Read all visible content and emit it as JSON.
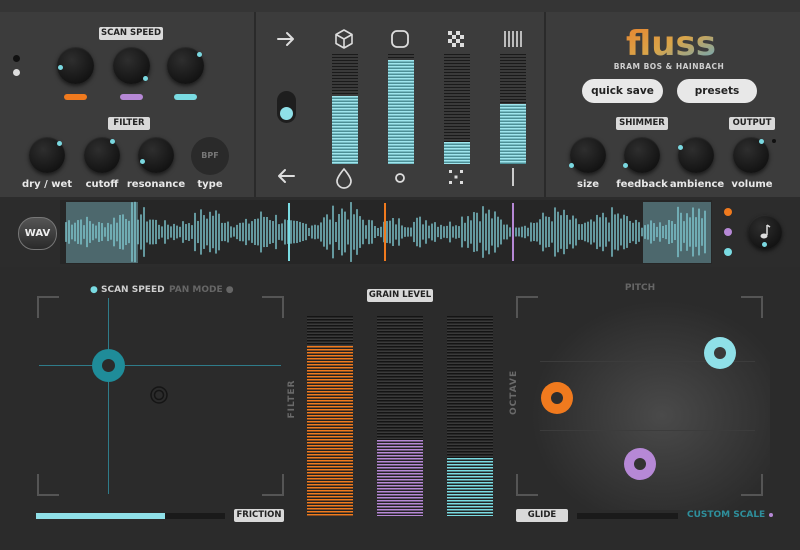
{
  "top": {
    "scan_speed_label": "SCAN SPEED",
    "filter_label": "FILTER",
    "filter_knobs": [
      {
        "label": "dry / wet"
      },
      {
        "label": "cutoff"
      },
      {
        "label": "resonance"
      },
      {
        "label": "type",
        "button_text": "BPF"
      }
    ],
    "scan_speed_colors": [
      "#f07a1e",
      "#b688d6",
      "#7adbe2"
    ],
    "sliders": [
      {
        "top_icon": "cube-icon",
        "bottom_icon": "drop-icon",
        "level": 0.62
      },
      {
        "top_icon": "rounded-square-icon",
        "bottom_icon": "small-circle-icon",
        "level": 0.95
      },
      {
        "top_icon": "checker-icon",
        "bottom_icon": "scatter-dots-icon",
        "level": 0.2
      },
      {
        "top_icon": "bars-icon",
        "bottom_icon": "single-line-icon",
        "level": 0.55
      }
    ],
    "logo_text": "fluss",
    "brand_text": "BRAM BOS & HAINBACH",
    "quick_save_label": "quick save",
    "presets_label": "presets",
    "shimmer_label": "SHIMMER",
    "output_label": "OUTPUT",
    "shimmer_knobs": [
      {
        "label": "size"
      },
      {
        "label": "feedback"
      },
      {
        "label": "ambience"
      }
    ],
    "output_knob": {
      "label": "volume"
    }
  },
  "wave": {
    "wav_label": "WAV",
    "colors": {
      "orange": "#f07a1e",
      "purple": "#b688d6",
      "cyan": "#7adbe2"
    }
  },
  "bottom": {
    "scan_speed_tab": "SCAN SPEED",
    "pan_mode_tab": "PAN MODE",
    "filter_label": "FILTER",
    "grain_level_label": "GRAIN LEVEL",
    "grain_levels": [
      0.85,
      0.38,
      0.29
    ],
    "grain_colors": [
      "#f07a1e",
      "#b688d6",
      "#7adbe2"
    ],
    "friction_label": "FRICTION",
    "friction_level": 0.68,
    "pitch_label": "PITCH",
    "octave_label": "OCTAVE",
    "glide_label": "GLIDE",
    "custom_scale_label": "CUSTOM SCALE"
  }
}
